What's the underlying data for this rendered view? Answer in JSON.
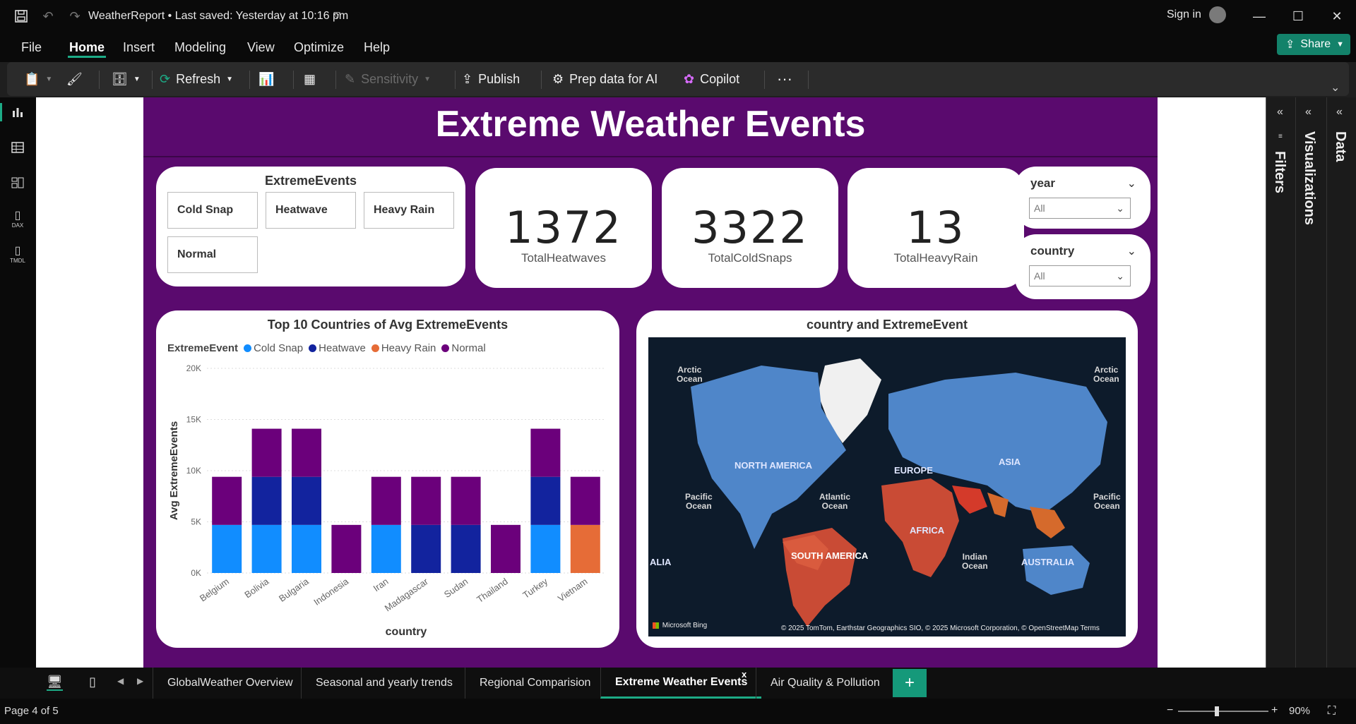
{
  "app": {
    "title": "WeatherReport • Last saved: Yesterday at 10:16 pm",
    "sign_in": "Sign in",
    "share": "Share"
  },
  "menu": [
    "File",
    "Home",
    "Insert",
    "Modeling",
    "View",
    "Optimize",
    "Help"
  ],
  "ribbon": {
    "refresh": "Refresh",
    "sensitivity": "Sensitivity",
    "publish": "Publish",
    "prep_data": "Prep data for AI",
    "copilot": "Copilot",
    "more": "···"
  },
  "nav_icons": [
    "report-view-icon",
    "table-view-icon",
    "model-view-icon",
    "dax-query-icon",
    "tmdl-view-icon"
  ],
  "nav_labels": {
    "dax": "DAX",
    "tmdl": "TMDL"
  },
  "report": {
    "title": "Extreme Weather Events",
    "slicer": {
      "title": "ExtremeEvents",
      "items": [
        "Cold Snap",
        "Heatwave",
        "Heavy Rain",
        "Normal"
      ]
    },
    "kpis": [
      {
        "value": "1372",
        "label": "TotalHeatwaves"
      },
      {
        "value": "3322",
        "label": "TotalColdSnaps"
      },
      {
        "value": "13",
        "label": "TotalHeavyRain"
      }
    ],
    "dropdowns": [
      {
        "title": "year",
        "value": "All"
      },
      {
        "title": "country",
        "value": "All"
      }
    ],
    "map": {
      "title": "country and ExtremeEvent",
      "labels": {
        "arctic_left": "Arctic\nOcean",
        "arctic_right": "Arctic\nOcean",
        "north_america": "NORTH AMERICA",
        "europe": "EUROPE",
        "asia": "ASIA",
        "pacific_left": "Pacific\nOcean",
        "pacific_right": "Pacific\nOcean",
        "atlantic": "Atlantic\nOcean",
        "africa": "AFRICA",
        "south_america": "SOUTH AMERICA",
        "indian": "Indian\nOcean",
        "australia": "AUSTRALIA",
        "alia": "ALIA"
      },
      "bing": "Microsoft Bing",
      "credit": "© 2025 TomTom, Earthstar Geographics SIO, © 2025 Microsoft Corporation, © OpenStreetMap  Terms"
    }
  },
  "chart_data": {
    "type": "bar",
    "stacked": true,
    "title": "Top 10 Countries of Avg ExtremeEvents",
    "xlabel": "country",
    "ylabel": "Avg ExtremeEvents",
    "ylim": [
      0,
      20000
    ],
    "yticks": [
      "0K",
      "5K",
      "10K",
      "15K",
      "20K"
    ],
    "legend_title": "ExtremeEvent",
    "categories": [
      "Belgium",
      "Bolivia",
      "Bulgaria",
      "Indonesia",
      "Iran",
      "Madagascar",
      "Sudan",
      "Thailand",
      "Turkey",
      "Vietnam"
    ],
    "series": [
      {
        "name": "Cold Snap",
        "color": "#118DFF",
        "values": [
          4700,
          4700,
          4700,
          0,
          4700,
          0,
          0,
          0,
          4700,
          0
        ]
      },
      {
        "name": "Heatwave",
        "color": "#12239E",
        "values": [
          0,
          4700,
          4700,
          0,
          0,
          4700,
          4700,
          0,
          4700,
          0
        ]
      },
      {
        "name": "Heavy Rain",
        "color": "#E66C37",
        "values": [
          0,
          0,
          0,
          0,
          0,
          0,
          0,
          0,
          0,
          4700
        ]
      },
      {
        "name": "Normal",
        "color": "#6B007B",
        "values": [
          4700,
          4700,
          4700,
          4700,
          4700,
          4700,
          4700,
          4700,
          4700,
          4700
        ]
      }
    ],
    "grid": true,
    "legend_position": "top-left"
  },
  "pages": [
    "GlobalWeather Overview",
    "Seasonal and yearly trends",
    "Regional Comparision",
    "Extreme Weather Events",
    "Air Quality & Pollution"
  ],
  "active_page_close": "x",
  "add_page": "+",
  "status": {
    "page": "Page 4 of 5",
    "zoom": "90%"
  },
  "right_panes": {
    "filters": "Filters",
    "visualizations": "Visualizations",
    "data": "Data"
  }
}
